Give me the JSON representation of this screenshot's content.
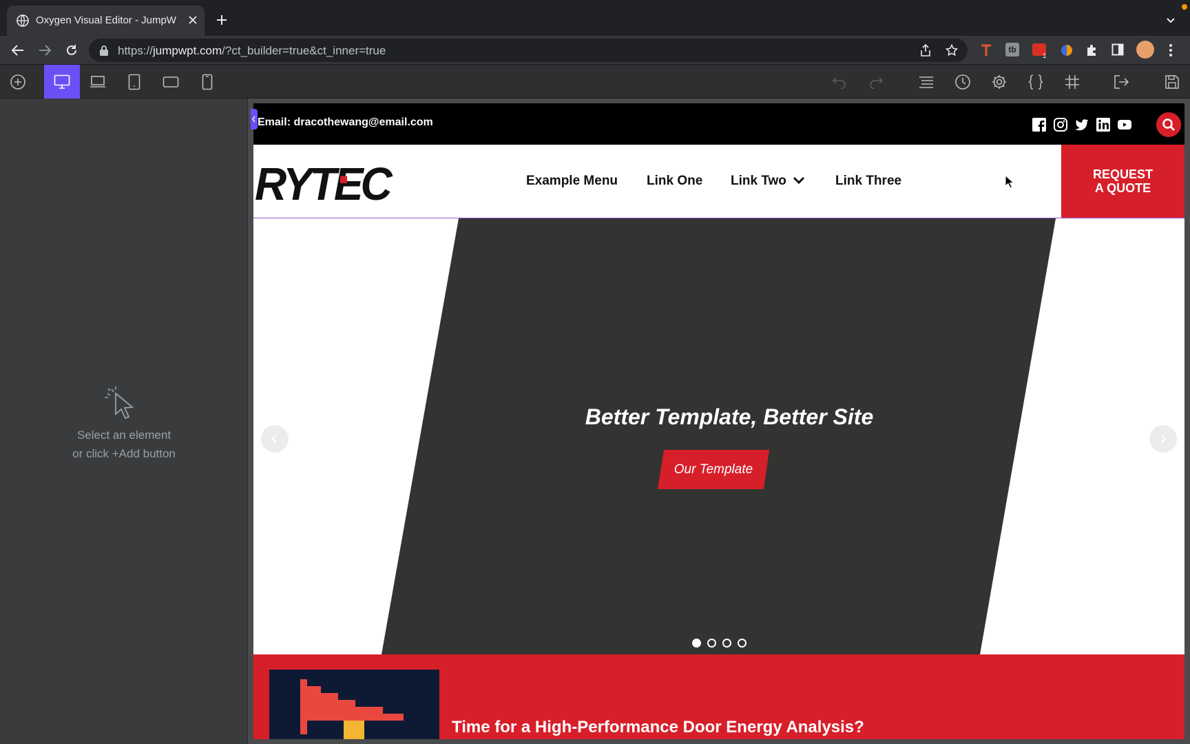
{
  "browser": {
    "tab_title": "Oxygen Visual Editor - JumpW",
    "url_prefix": "https://",
    "url_domain": "jumpwpt.com",
    "url_path": "/?ct_builder=true&ct_inner=true",
    "extension_badge": "1"
  },
  "editor": {
    "hint_line1": "Select an element",
    "hint_line2": "or click +Add button",
    "active_device": "desktop",
    "accent_color": "#6b4ff6"
  },
  "site": {
    "email": "Email: dracothewang@email.com",
    "logo": "RYTEC",
    "nav": [
      "Example Menu",
      "Link One",
      "Link Two",
      "Link Three"
    ],
    "quote_line1": "REQUEST",
    "quote_line2": "A QUOTE",
    "hero_title": "Better Template, Better Site",
    "hero_button": "Our Template",
    "banner_title": "Time for a High-Performance Door Energy Analysis?",
    "brand_color": "#d71f2a",
    "slides": 4,
    "active_slide": 1
  }
}
